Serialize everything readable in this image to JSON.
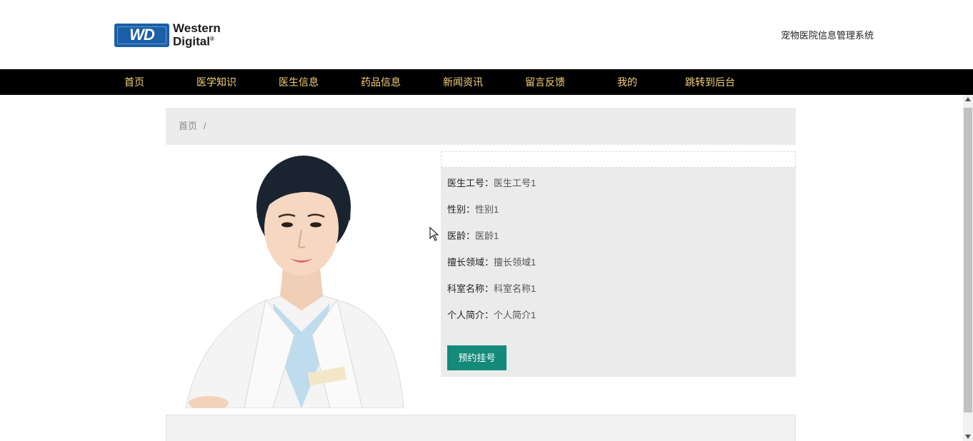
{
  "header": {
    "logo_badge": "WD",
    "logo_line1": "Western",
    "logo_line2": "Digital",
    "logo_mark": "®",
    "site_title": "宠物医院信息管理系统",
    "brand_color": "#1a5fa8"
  },
  "nav": {
    "items": [
      {
        "label": "首页"
      },
      {
        "label": "医学知识"
      },
      {
        "label": "医生信息"
      },
      {
        "label": "药品信息"
      },
      {
        "label": "新闻资讯"
      },
      {
        "label": "留言反馈"
      },
      {
        "label": "我的"
      },
      {
        "label": "跳转到后台"
      }
    ],
    "bg_color": "#000000",
    "text_color": "#f5d27a"
  },
  "breadcrumb": {
    "home": "首页",
    "separator": "/"
  },
  "doctor": {
    "photo_icon": "doctor-portrait-image",
    "fields": [
      {
        "label": "医生工号：",
        "value": "医生工号1"
      },
      {
        "label": "性别：",
        "value": "性别1"
      },
      {
        "label": "医龄：",
        "value": "医龄1"
      },
      {
        "label": "擅长领域：",
        "value": "擅长领域1"
      },
      {
        "label": "科室名称：",
        "value": "科室名称1"
      },
      {
        "label": "个人简介：",
        "value": "个人简介1"
      }
    ],
    "book_button": "预约挂号",
    "button_color": "#148a7b"
  }
}
